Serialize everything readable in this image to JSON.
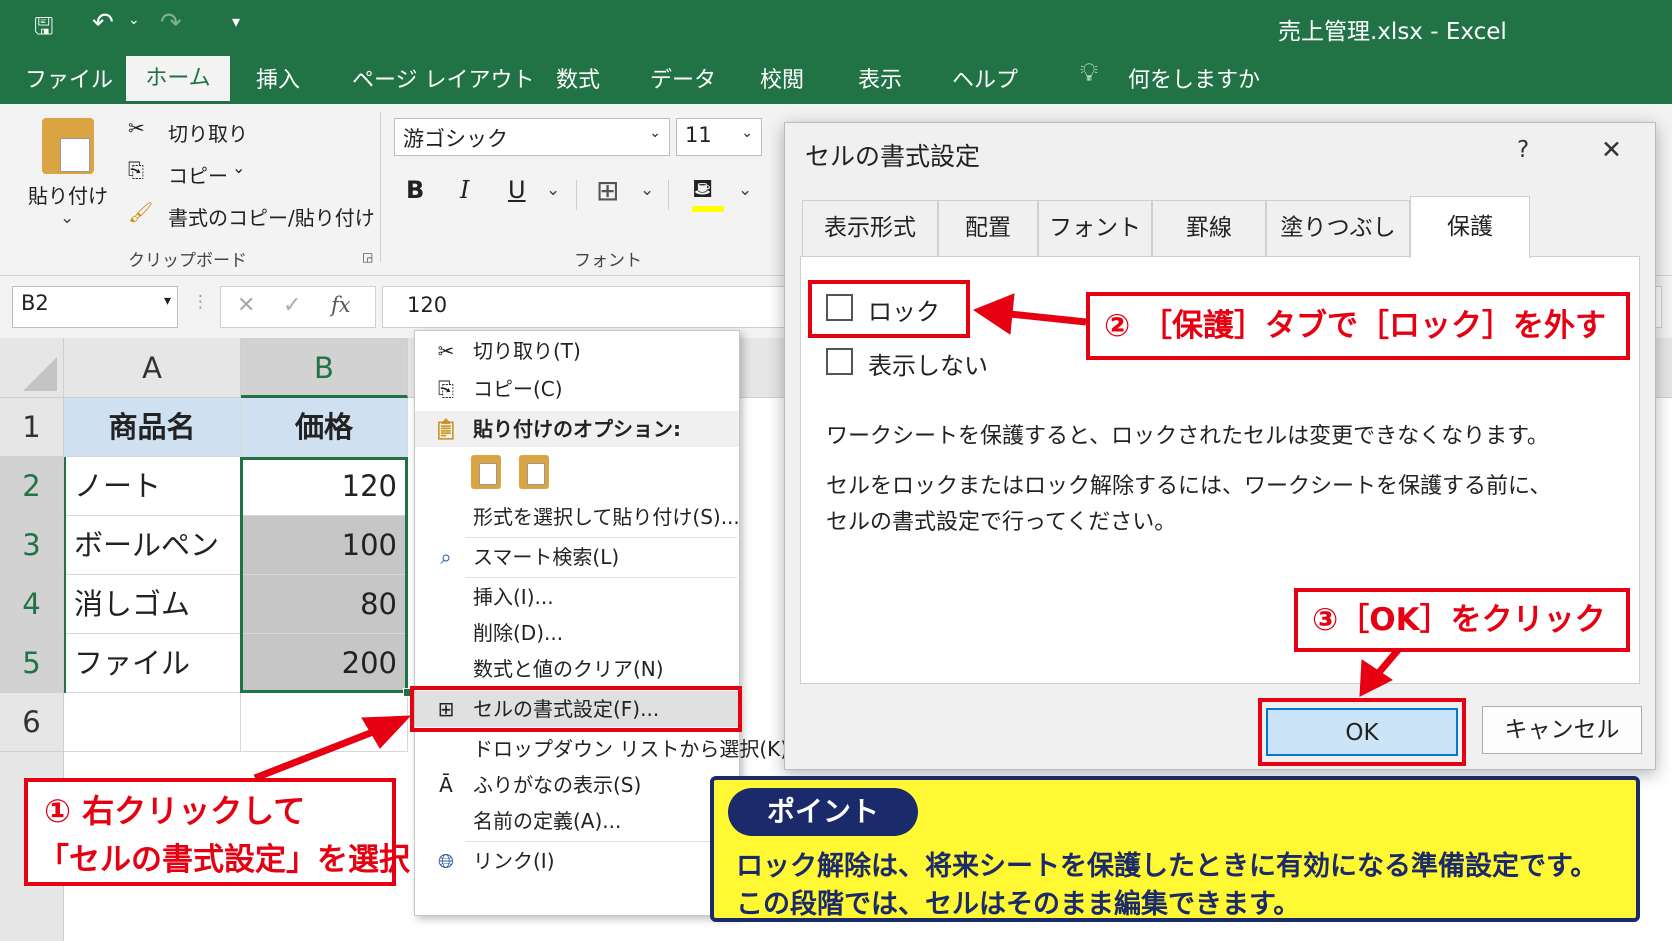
{
  "window": {
    "title": "売上管理.xlsx  -  Excel"
  },
  "tabs": [
    "ファイル",
    "ホーム",
    "挿入",
    "ページ レイアウト",
    "数式",
    "データ",
    "校閲",
    "表示",
    "ヘルプ"
  ],
  "tell_me": "何をしますか",
  "ribbon": {
    "paste": "貼り付け",
    "cut": "切り取り",
    "copy": "コピー",
    "format_painter": "書式のコピー/貼り付け",
    "clipboard_group": "クリップボード",
    "font_name": "游ゴシック",
    "font_size": "11",
    "bold": "B",
    "italic": "I",
    "underline": "U",
    "font_group": "フォント"
  },
  "formula_bar": {
    "name_box": "B2",
    "value": "120",
    "fx": "fx"
  },
  "sheet": {
    "col_headers": [
      "A",
      "B"
    ],
    "row_headers": [
      "1",
      "2",
      "3",
      "4",
      "5",
      "6"
    ],
    "rows": [
      [
        "商品名",
        "価格"
      ],
      [
        "ノート",
        "120"
      ],
      [
        "ボールペン",
        "100"
      ],
      [
        "消しゴム",
        "80"
      ],
      [
        "ファイル",
        "200"
      ]
    ]
  },
  "context_menu": {
    "cut": "切り取り(T)",
    "copy": "コピー(C)",
    "paste_options": "貼り付けのオプション:",
    "paste_special": "形式を選択して貼り付け(S)...",
    "smart_lookup": "スマート検索(L)",
    "insert": "挿入(I)...",
    "delete": "削除(D)...",
    "clear": "数式と値のクリア(N)",
    "format_cells": "セルの書式設定(F)...",
    "dropdown": "ドロップダウン リストから選択(K)...",
    "furigana": "ふりがなの表示(S)",
    "define_name": "名前の定義(A)...",
    "link": "リンク(I)"
  },
  "dialog": {
    "title": "セルの書式設定",
    "help": "?",
    "close": "✕",
    "tabs": [
      "表示形式",
      "配置",
      "フォント",
      "罫線",
      "塗りつぶし",
      "保護"
    ],
    "lock": "ロック",
    "hidden": "表示しない",
    "note1": "ワークシートを保護すると、ロックされたセルは変更できなくなります。",
    "note2": "セルをロックまたはロック解除するには、ワークシートを保護する前に、",
    "note3": "セルの書式設定で行ってください。",
    "ok": "OK",
    "cancel": "キャンセル"
  },
  "callouts": {
    "step1_line1": "① 右クリックして",
    "step1_line2": "「セルの書式設定」を選択",
    "step2": "② ［保護］タブで［ロック］を外す",
    "step3": "③［OK］をクリック"
  },
  "point": {
    "label": "ポイント",
    "line1": "ロック解除は、将来シートを保護したときに有効になる準備設定です。",
    "line2": "この段階では、セルはそのまま編集できます。"
  },
  "colors": {
    "excel_green": "#217346",
    "callout_red": "#e60012",
    "point_yellow": "#fff833",
    "point_navy": "#1b2a6b"
  }
}
